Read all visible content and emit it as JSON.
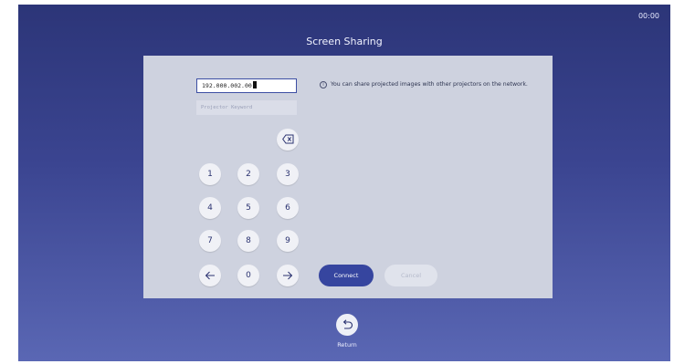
{
  "clock": "00:00",
  "title": "Screen Sharing",
  "ip_field": {
    "value": "192.000.002.00",
    "cursor_char": "0"
  },
  "keyword_field": {
    "placeholder": "Projector Keyword"
  },
  "keypad": {
    "backspace_icon": "backspace-icon",
    "keys": [
      "1",
      "2",
      "3",
      "4",
      "5",
      "6",
      "7",
      "8",
      "9",
      "0"
    ],
    "left_icon": "arrow-left-icon",
    "right_icon": "arrow-right-icon"
  },
  "info": {
    "icon": "info-icon",
    "icon_glyph": "i",
    "text": "You can share projected images with other projectors on the network."
  },
  "buttons": {
    "connect": "Connect",
    "cancel": "Cancel"
  },
  "return": {
    "label": "Return",
    "icon": "return-icon"
  },
  "colors": {
    "accent": "#36459f",
    "panel": "#ced2df",
    "background_top": "#2c3578",
    "background_bottom": "#5a67b4"
  }
}
